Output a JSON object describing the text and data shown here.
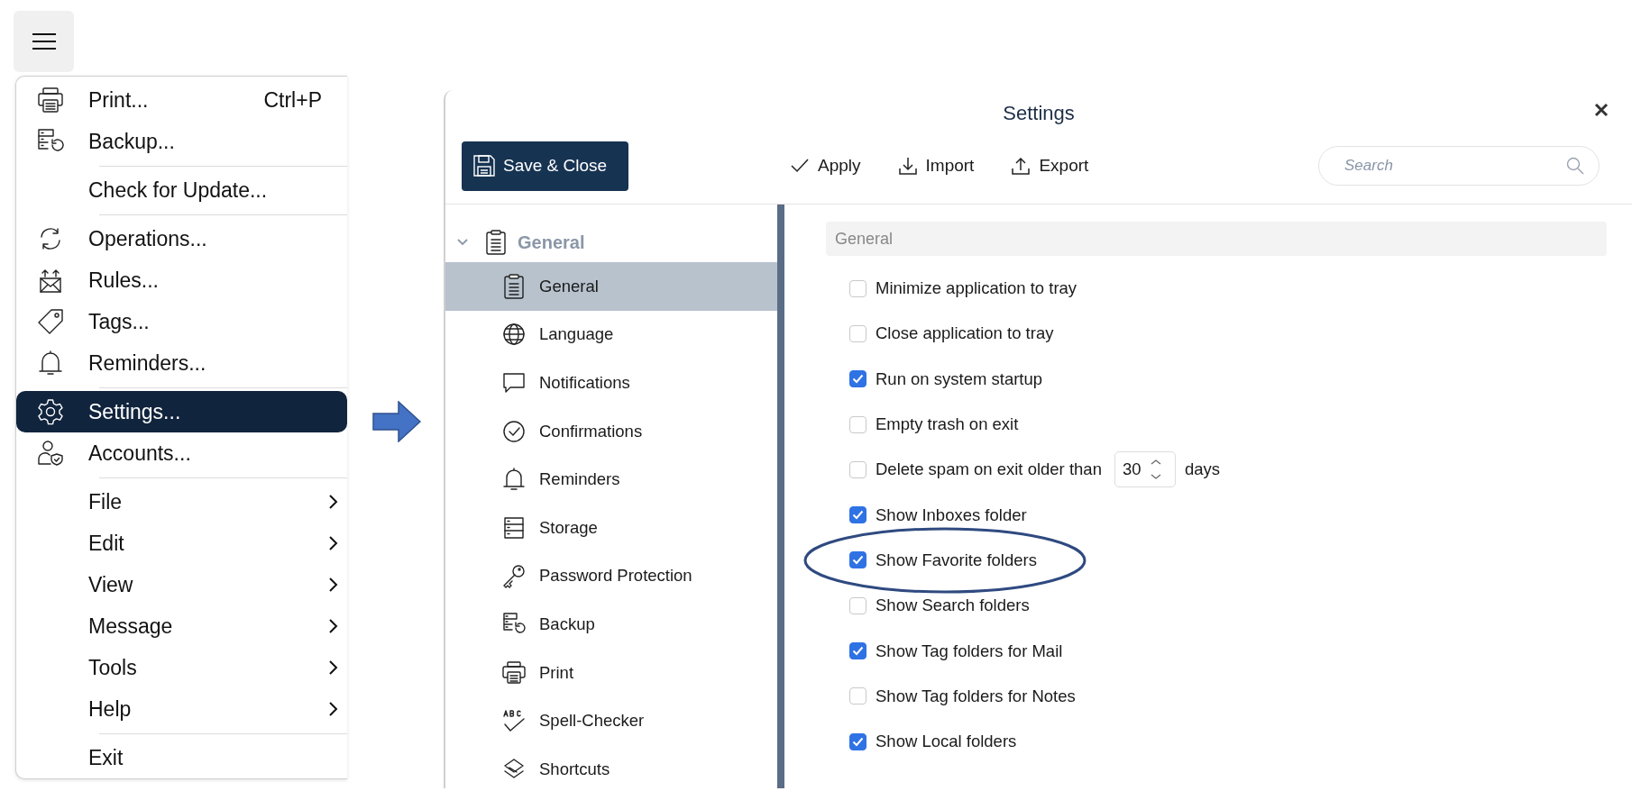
{
  "menu": {
    "items": [
      {
        "kind": "item",
        "label": "Print...",
        "shortcut": "Ctrl+P",
        "selected": false
      },
      {
        "kind": "item",
        "label": "Backup...",
        "selected": false
      },
      {
        "kind": "separator"
      },
      {
        "kind": "item",
        "label": "Check for Update...",
        "selected": false
      },
      {
        "kind": "separator"
      },
      {
        "kind": "item",
        "label": "Operations...",
        "selected": false
      },
      {
        "kind": "item",
        "label": "Rules...",
        "selected": false
      },
      {
        "kind": "item",
        "label": "Tags...",
        "selected": false
      },
      {
        "kind": "item",
        "label": "Reminders...",
        "selected": false
      },
      {
        "kind": "separator"
      },
      {
        "kind": "item",
        "label": "Settings...",
        "selected": true
      },
      {
        "kind": "item",
        "label": "Accounts...",
        "selected": false
      },
      {
        "kind": "separator"
      },
      {
        "kind": "item",
        "label": "File",
        "submenu": true,
        "selected": false
      },
      {
        "kind": "item",
        "label": "Edit",
        "submenu": true,
        "selected": false
      },
      {
        "kind": "item",
        "label": "View",
        "submenu": true,
        "selected": false
      },
      {
        "kind": "item",
        "label": "Message",
        "submenu": true,
        "selected": false
      },
      {
        "kind": "item",
        "label": "Tools",
        "submenu": true,
        "selected": false
      },
      {
        "kind": "item",
        "label": "Help",
        "submenu": true,
        "selected": false
      },
      {
        "kind": "separator"
      },
      {
        "kind": "item",
        "label": "Exit",
        "selected": false
      }
    ]
  },
  "settings": {
    "title": "Settings",
    "save_button": "Save & Close",
    "actions": [
      "Apply",
      "Import",
      "Export"
    ],
    "search": {
      "placeholder": "Search"
    },
    "tree": {
      "label": "General",
      "expanded": true,
      "children": [
        {
          "label": "General",
          "selected": true
        },
        {
          "label": "Language",
          "selected": false
        },
        {
          "label": "Notifications",
          "selected": false
        },
        {
          "label": "Confirmations",
          "selected": false
        },
        {
          "label": "Reminders",
          "selected": false
        },
        {
          "label": "Storage",
          "selected": false
        },
        {
          "label": "Password Protection",
          "selected": false
        },
        {
          "label": "Backup",
          "selected": false
        },
        {
          "label": "Print",
          "selected": false
        },
        {
          "label": "Spell-Checker",
          "selected": false
        },
        {
          "label": "Shortcuts",
          "selected": false
        }
      ]
    },
    "section": "General",
    "options": [
      {
        "kind": "checkbox",
        "label": "Minimize application to tray",
        "checked": false
      },
      {
        "kind": "checkbox",
        "label": "Close application to tray",
        "checked": false
      },
      {
        "kind": "checkbox",
        "label": "Run on system startup",
        "checked": true
      },
      {
        "kind": "checkbox",
        "label": "Empty trash on exit",
        "checked": false
      },
      {
        "kind": "number",
        "label": "Delete spam on exit older than",
        "checked": false,
        "value": "30",
        "unit": "days"
      },
      {
        "kind": "checkbox",
        "label": "Show Inboxes folder",
        "checked": true
      },
      {
        "kind": "checkbox",
        "label": "Show Favorite folders",
        "checked": true
      },
      {
        "kind": "checkbox",
        "label": "Show Search folders",
        "checked": false
      },
      {
        "kind": "checkbox",
        "label": "Show Tag folders for Mail",
        "checked": true
      },
      {
        "kind": "checkbox",
        "label": "Show Tag folders for Notes",
        "checked": false
      },
      {
        "kind": "checkbox",
        "label": "Show Local folders",
        "checked": true
      }
    ]
  }
}
